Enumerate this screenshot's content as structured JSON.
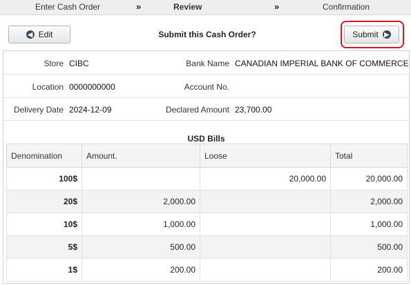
{
  "steps": [
    "Enter Cash Order",
    "Review",
    "Confirmation"
  ],
  "step_separator": "»",
  "active_step": "Review",
  "header": {
    "edit_label": "Edit",
    "title": "Submit this Cash Order?",
    "submit_label": "Submit"
  },
  "icons": {
    "edit": "arrow-left-circle-icon",
    "submit": "arrow-right-circle-icon"
  },
  "colors": {
    "highlight": "#e0141e",
    "icon": "#3b4a5a"
  },
  "details": {
    "store_label": "Store",
    "store_value": "CIBC",
    "bank_label": "Bank Name",
    "bank_value": "CANADIAN IMPERIAL BANK OF COMMERCE",
    "location_label": "Location",
    "location_value": "0000000000",
    "account_label": "Account No.",
    "account_value": "",
    "delivery_label": "Delivery Date",
    "delivery_value": "2024-12-09",
    "declared_label": "Declared Amount",
    "declared_value": "23,700.00"
  },
  "bills": {
    "title": "USD Bills",
    "columns": [
      "Denomination",
      "Amount.",
      "Loose",
      "Total"
    ],
    "rows": [
      [
        "100$",
        "",
        "20,000.00",
        "20,000.00"
      ],
      [
        "20$",
        "2,000.00",
        "",
        "2,000.00"
      ],
      [
        "10$",
        "1,000.00",
        "",
        "1,000.00"
      ],
      [
        "5$",
        "500.00",
        "",
        "500.00"
      ],
      [
        "1$",
        "200.00",
        "",
        "200.00"
      ]
    ]
  }
}
